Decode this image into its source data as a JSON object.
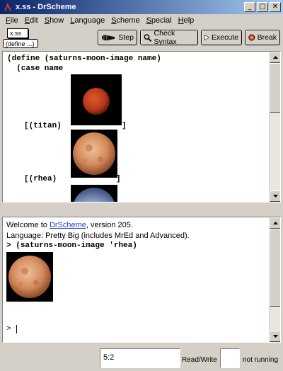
{
  "window": {
    "title": "x.ss - DrScheme"
  },
  "menubar": {
    "items": [
      {
        "first": "F",
        "rest": "ile"
      },
      {
        "first": "E",
        "rest": "dit"
      },
      {
        "first": "S",
        "rest": "how"
      },
      {
        "first": "L",
        "rest": "anguage"
      },
      {
        "first": "S",
        "rest": "cheme"
      },
      {
        "first": "S",
        "rest": "pecial"
      },
      {
        "first": "H",
        "rest": "elp"
      }
    ]
  },
  "toolbar": {
    "file_tag": "x.ss",
    "define_tag": "(define ...)",
    "step_label": "Step",
    "check_syntax_label": "Check Syntax",
    "execute_label": "Execute",
    "break_label": "Break"
  },
  "definitions": {
    "line1": "(define (saturns-moon-image name)",
    "line2": "  (case name",
    "case_titan": "[(titan)",
    "case_rhea": "[(rhea)",
    "close_bracket": "]"
  },
  "interactions": {
    "welcome_prefix": "Welcome to ",
    "welcome_link": "DrScheme",
    "welcome_suffix": ", version 205.",
    "language_prefix": "Language: ",
    "language_value": "Pretty Big (includes MrEd and Advanced).",
    "prompt": ">",
    "command": "(saturns-moon-image 'rhea)",
    "input_prompt": ">"
  },
  "status": {
    "position": "5:2",
    "mode": "Read/Write",
    "run_state": "not running"
  },
  "colors": {
    "titlebar_start": "#0a246a",
    "link": "#1a3fd6",
    "break_icon": "#cc2a1a"
  }
}
